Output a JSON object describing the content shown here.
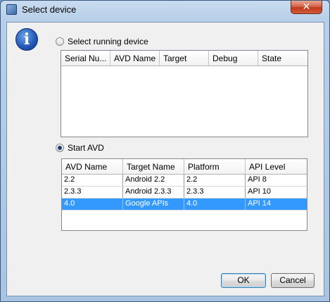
{
  "window": {
    "title": "Select device"
  },
  "dialog": {
    "running_option": {
      "label": "Select running device",
      "checked": false
    },
    "running_table": {
      "columns": [
        "Serial Nu...",
        "AVD Name",
        "Target",
        "Debug",
        "State"
      ],
      "rows": []
    },
    "avd_option": {
      "label": "Start AVD",
      "checked": true
    },
    "avd_table": {
      "columns": [
        "AVD Name",
        "Target Name",
        "Platform",
        "API Level"
      ],
      "rows": [
        {
          "avd_name": "2.2",
          "target_name": "Android 2.2",
          "platform": "2.2",
          "api_level": "API 8",
          "selected": false
        },
        {
          "avd_name": "2.3.3",
          "target_name": "Android 2.3.3",
          "platform": "2.3.3",
          "api_level": "API 10",
          "selected": false
        },
        {
          "avd_name": "4.0",
          "target_name": "Google APIs",
          "platform": "4.0",
          "api_level": "API 14",
          "selected": true
        }
      ]
    }
  },
  "buttons": {
    "ok": "OK",
    "cancel": "Cancel"
  },
  "icons": {
    "app": "device-icon",
    "info": "info-icon",
    "close": "close-icon"
  },
  "colors": {
    "selection": "#3399ff",
    "close": "#c0391b"
  }
}
